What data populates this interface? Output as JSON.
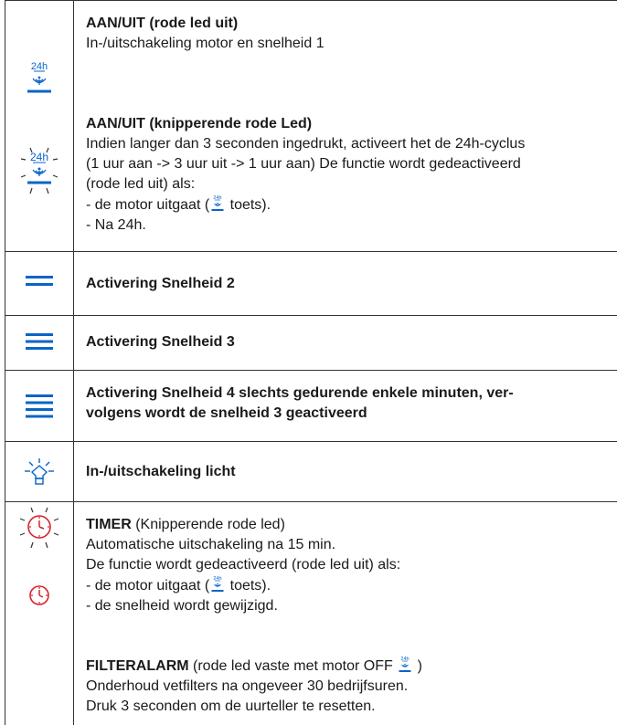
{
  "colors": {
    "accent_blue": "#0a64c8",
    "alert_red": "#d9232e",
    "border": "#333333"
  },
  "rows": [
    {
      "icon": "fan-24h-icon",
      "title": "AAN/UIT (rode led uit)",
      "lines": [
        "In-/uitschakeling motor en snelheid 1"
      ]
    },
    {
      "icon": "fan-24h-blinking-icon",
      "title": "AAN/UIT (knipperende rode Led)",
      "lines": [
        "Indien langer dan 3 seconden ingedrukt, activeert het de 24h-cyclus",
        "(1 uur aan -> 3 uur uit -> 1 uur aan) De functie wordt gedeactiveerd",
        "(rode led uit) als:",
        "- de motor uitgaat (",
        " toets).",
        "- Na 24h."
      ]
    },
    {
      "icon": "speed-2-icon",
      "title": "Activering Snelheid 2"
    },
    {
      "icon": "speed-3-icon",
      "title": "Activering Snelheid 3"
    },
    {
      "icon": "speed-4-icon",
      "title_lines": [
        "Activering Snelheid 4 slechts gedurende enkele minuten, ver-",
        "volgens wordt de snelheid 3 geactiveerd"
      ]
    },
    {
      "icon": "light-bulb-icon",
      "title": "In-/uitschakeling licht"
    },
    {
      "icon": "timer-blinking-icon",
      "title": "TIMER",
      "title_suffix": " (Knipperende rode led)",
      "lines": [
        "Automatische uitschakeling na 15 min.",
        "De functie wordt gedeactiveerd (rode led uit) als:",
        "- de motor uitgaat (",
        " toets).",
        "- de snelheid wordt gewijzigd."
      ]
    },
    {
      "icon": "timer-icon",
      "title": "FILTERALARM",
      "title_suffix": " (rode led vaste met motor OFF ",
      "title_suffix_end": " )",
      "lines": [
        "Onderhoud vetfilters na ongeveer 30 bedrijfsuren.",
        "Druk 3 seconden om de uurteller te resetten."
      ]
    }
  ]
}
